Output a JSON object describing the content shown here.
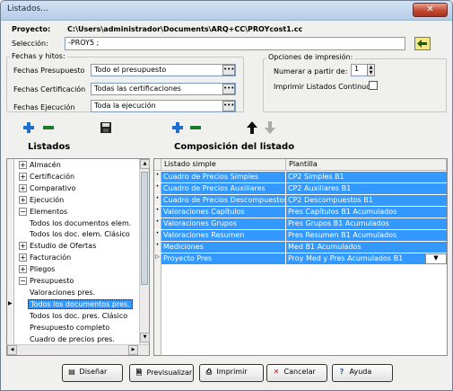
{
  "window": {
    "title": "Listados...",
    "close": "✕"
  },
  "project": {
    "label": "Proyecto:",
    "path": "C:\\Users\\administrador\\Documents\\ARQ+CC\\PROYcost1.cc"
  },
  "selection": {
    "label": "Selección:",
    "value": "-PROY5 ;"
  },
  "fechas": {
    "group_title": "Fechas y hitos:",
    "rows": [
      {
        "label": "Fechas Presupuesto",
        "value": "Todo el presupuesto"
      },
      {
        "label": "Fechas Certificación",
        "value": "Todas las certificaciones"
      },
      {
        "label": "Fechas Ejecución",
        "value": "Toda la ejecución"
      }
    ],
    "dots": "•••"
  },
  "opciones": {
    "group_title": "Opciones de impresión:",
    "numerar_label": "Numerar a partir de:",
    "numerar_value": "1",
    "continuos_label": "Imprimir Listados Continuos",
    "continuos_checked": false
  },
  "left": {
    "title": "Listados",
    "tree": [
      {
        "text": "Almacén",
        "kind": "node"
      },
      {
        "text": "Certificación",
        "kind": "node"
      },
      {
        "text": "Comparativo",
        "kind": "node"
      },
      {
        "text": "Ejecución",
        "kind": "node"
      },
      {
        "text": "Elementos",
        "kind": "open"
      },
      {
        "text": "Todos los documentos elem.",
        "kind": "leaf"
      },
      {
        "text": "Todos los doc. elem. Clásico",
        "kind": "leaf"
      },
      {
        "text": "Estudio de Ofertas",
        "kind": "node"
      },
      {
        "text": "Facturación",
        "kind": "node"
      },
      {
        "text": "Pliegos",
        "kind": "node"
      },
      {
        "text": "Presupuesto",
        "kind": "open"
      },
      {
        "text": "Valoraciones pres.",
        "kind": "leaf"
      },
      {
        "text": "Todos los documentos pres.",
        "kind": "selected"
      },
      {
        "text": "Todos los doc. pres. Clásico",
        "kind": "leaf"
      },
      {
        "text": "Presupuesto completo",
        "kind": "leaf"
      },
      {
        "text": "Cuadro de precios pres.",
        "kind": "leaf"
      }
    ]
  },
  "right": {
    "title": "Composición del listado",
    "headers": [
      "Listado simple",
      "Plantilla"
    ],
    "rows": [
      {
        "listado": "Cuadro de Precios Simples",
        "plantilla": "CP2 Simples B1"
      },
      {
        "listado": "Cuadro de Precios Auxiliares",
        "plantilla": "CP2 Auxiliares B1"
      },
      {
        "listado": "Cuadro de Precios Descompuestos",
        "plantilla": "CP2 Descompuestos B1"
      },
      {
        "listado": "Valoraciones Capítulos",
        "plantilla": "Pres Capítulos B1 Acumulados"
      },
      {
        "listado": "Valoraciones Grupos",
        "plantilla": "Pres Grupos B1 Acumulados"
      },
      {
        "listado": "Valoraciones Resumen",
        "plantilla": "Pres Resumen B1 Acumulados"
      },
      {
        "listado": "Mediciones",
        "plantilla": "Med B1 Acumulados"
      },
      {
        "listado": "Proyecto Pres",
        "plantilla": "Proy Med y Pres Acumulados B1"
      }
    ]
  },
  "buttons": {
    "disenar": "Diseñar",
    "previsualizar": "Previsualizar",
    "imprimir": "Imprimir",
    "cancelar": "Cancelar",
    "ayuda": "Ayuda"
  },
  "colors": {
    "selection": "#3399ff",
    "add": "#1f6fd0",
    "remove": "#1a7a2a",
    "cancel": "#cc1111"
  }
}
